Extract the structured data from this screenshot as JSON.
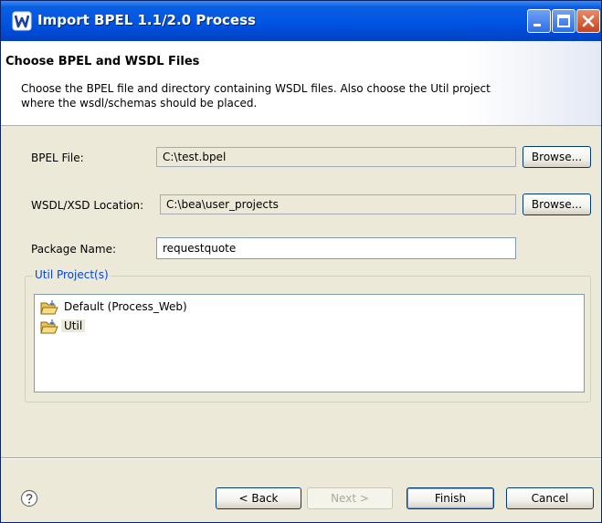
{
  "window": {
    "title": "Import BPEL 1.1/2.0 Process",
    "controls": [
      "minimize-icon",
      "maximize-icon",
      "close-icon"
    ],
    "colors": {
      "titlebar": "#0054e3",
      "accent_link": "#0046d5",
      "background": "#ece9d8"
    }
  },
  "header": {
    "title": "Choose BPEL and WSDL Files",
    "description": "Choose the BPEL file and directory containing WSDL files. Also choose the Util project where the wsdl/schemas should be placed."
  },
  "form": {
    "bpel_file": {
      "label": "BPEL File:",
      "value": "C:\\test.bpel",
      "browse": "Browse..."
    },
    "wsdl_location": {
      "label": "WSDL/XSD Location:",
      "value": "C:\\bea\\user_projects",
      "browse": "Browse..."
    },
    "package_name": {
      "label": "Package Name:",
      "value": "requestquote"
    }
  },
  "util_projects": {
    "label": "Util Project(s)",
    "items": [
      {
        "label": "Default (Process_Web)",
        "icon": "folder-open-icon",
        "selected": false
      },
      {
        "label": "Util",
        "icon": "folder-open-icon",
        "selected": true
      }
    ]
  },
  "footer": {
    "help_icon": "help-icon",
    "back": "< Back",
    "next": "Next >",
    "finish": "Finish",
    "cancel": "Cancel"
  }
}
